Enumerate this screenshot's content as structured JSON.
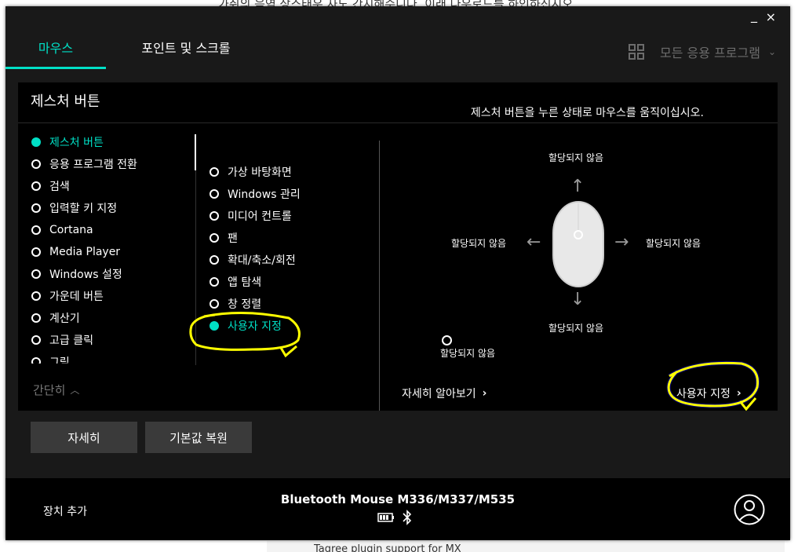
{
  "background": {
    "top_text": "가취의 음역 상스태우 자도 간지해수니다. 이래 다우로드를 하인하신시오",
    "bottom_text": "Tagree plugin support for MX"
  },
  "window": {
    "minimize": "_",
    "close": "×"
  },
  "tabs": [
    {
      "label": "마우스",
      "active": true
    },
    {
      "label": "포인트 및 스크롤",
      "active": false
    }
  ],
  "apps": {
    "label": "모든 응용 프로그램",
    "icon": "grid-icon"
  },
  "panel": {
    "title": "제스처 버튼",
    "instruction": "제스처 버튼을 누른 상태로 마우스를 움직이십시오."
  },
  "action_list": [
    {
      "label": "제스처 버튼",
      "selected": true
    },
    {
      "label": "응용 프로그램 전환",
      "selected": false
    },
    {
      "label": "검색",
      "selected": false
    },
    {
      "label": "입력할 키 지정",
      "selected": false
    },
    {
      "label": "Cortana",
      "selected": false
    },
    {
      "label": "Media Player",
      "selected": false
    },
    {
      "label": "Windows 설정",
      "selected": false
    },
    {
      "label": "가운데 버튼",
      "selected": false
    },
    {
      "label": "계산기",
      "selected": false
    },
    {
      "label": "고급 클릭",
      "selected": false
    },
    {
      "label": "그림",
      "selected": false
    }
  ],
  "gesture_list": [
    {
      "label": "가상 바탕화면",
      "selected": false
    },
    {
      "label": "Windows 관리",
      "selected": false
    },
    {
      "label": "미디어 컨트롤",
      "selected": false
    },
    {
      "label": "팬",
      "selected": false
    },
    {
      "label": "확대/축소/회전",
      "selected": false
    },
    {
      "label": "앱 탐색",
      "selected": false
    },
    {
      "label": "창 정렬",
      "selected": false
    },
    {
      "label": "사용자 지정",
      "selected": true
    }
  ],
  "collapse_label": "간단히",
  "directions": {
    "up": "할당되지 않음",
    "left": "할당되지 않음",
    "right": "할당되지 않음",
    "down": "할당되지 않음",
    "click": "할당되지 않음"
  },
  "links": {
    "learn_more": "자세히 알아보기",
    "customize": "사용자 지정"
  },
  "buttons": {
    "detail": "자세히",
    "reset": "기본값 복원"
  },
  "footer": {
    "add_device": "장치 추가",
    "device_name": "Bluetooth Mouse M336/M337/M535"
  },
  "colors": {
    "accent": "#00e0c6",
    "annotation": "#ffff00",
    "window_bg": "#191919"
  }
}
